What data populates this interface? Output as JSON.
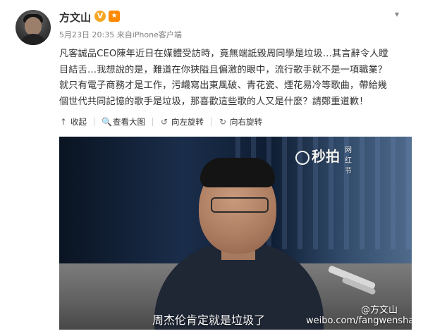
{
  "post": {
    "author": "方文山",
    "verified_mark": "V",
    "badge": "★",
    "meta": {
      "date": "5月23日 20:35",
      "source_prefix": "来自",
      "source": "iPhone客户端"
    },
    "text_lines": [
      "凡客誠品CEO陳年近日在媒體受訪時，竟無端詆毀周同學是垃圾…其言辭令人瞠",
      "目結舌…我想說的是，難道在你狹隘且偏激的眼中，流行歌手就不是一項職業？",
      "就只有電子商務才是工作，污衊寫出東風破、青花瓷、煙花易冷等歌曲，帶給幾",
      "個世代共同記憶的歌手是垃圾，那喜歡這些歌的人又是什麼？請鄭重道歉！"
    ],
    "chevron": "▾"
  },
  "toolbar": {
    "collapse": {
      "icon": "↑",
      "label": "收起"
    },
    "view_large": {
      "icon": "🔍",
      "label": "查看大图"
    },
    "rotate_left": {
      "icon": "↺",
      "label": "向左旋转"
    },
    "rotate_right": {
      "icon": "↻",
      "label": "向右旋转"
    }
  },
  "media": {
    "logo_text": "秒拍",
    "logo_sub": "网红节",
    "caption": "周杰伦肯定就是垃圾了",
    "watermark_name": "@方文山",
    "watermark_url": "weibo.com/fangwenshan"
  }
}
